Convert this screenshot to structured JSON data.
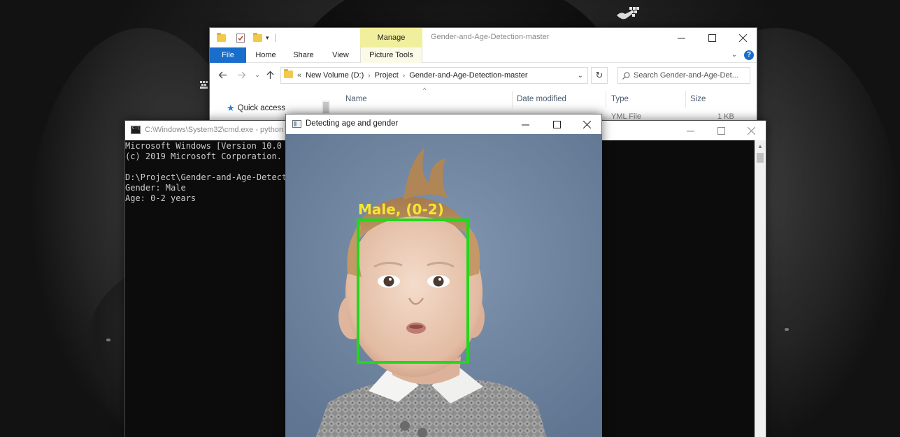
{
  "explorer": {
    "title": "Gender-and-Age-Detection-master",
    "contextual_tab": "Manage",
    "ribbon_tabs": [
      "File",
      "Home",
      "Share",
      "View",
      "Picture Tools"
    ],
    "breadcrumb_prefix": "«",
    "breadcrumb": [
      "New Volume (D:)",
      "Project",
      "Gender-and-Age-Detection-master"
    ],
    "search_placeholder": "Search Gender-and-Age-Det...",
    "nav_quick_access": "Quick access",
    "columns": [
      "Name",
      "Date modified",
      "Type",
      "Size"
    ],
    "visible_row": {
      "type": "YML File",
      "size": "1 KB"
    },
    "help_label": "?"
  },
  "console": {
    "title": "C:\\Windows\\System32\\cmd.exe - python",
    "lines": [
      "Microsoft Windows [Version 10.0",
      "(c) 2019 Microsoft Corporation.",
      "",
      "D:\\Project\\Gender-and-Age-Detect",
      "Gender: Male",
      "Age: 0-2 years"
    ]
  },
  "detection_window": {
    "title": "Detecting age and gender",
    "label": "Male, (0-2)"
  },
  "colors": {
    "box_green": "#22d81a",
    "label_yellow": "#f5e62e",
    "explorer_file_tab": "#1a6ecb",
    "manage_tab": "#f0ef9d",
    "console_bg": "#0c0c0c"
  }
}
